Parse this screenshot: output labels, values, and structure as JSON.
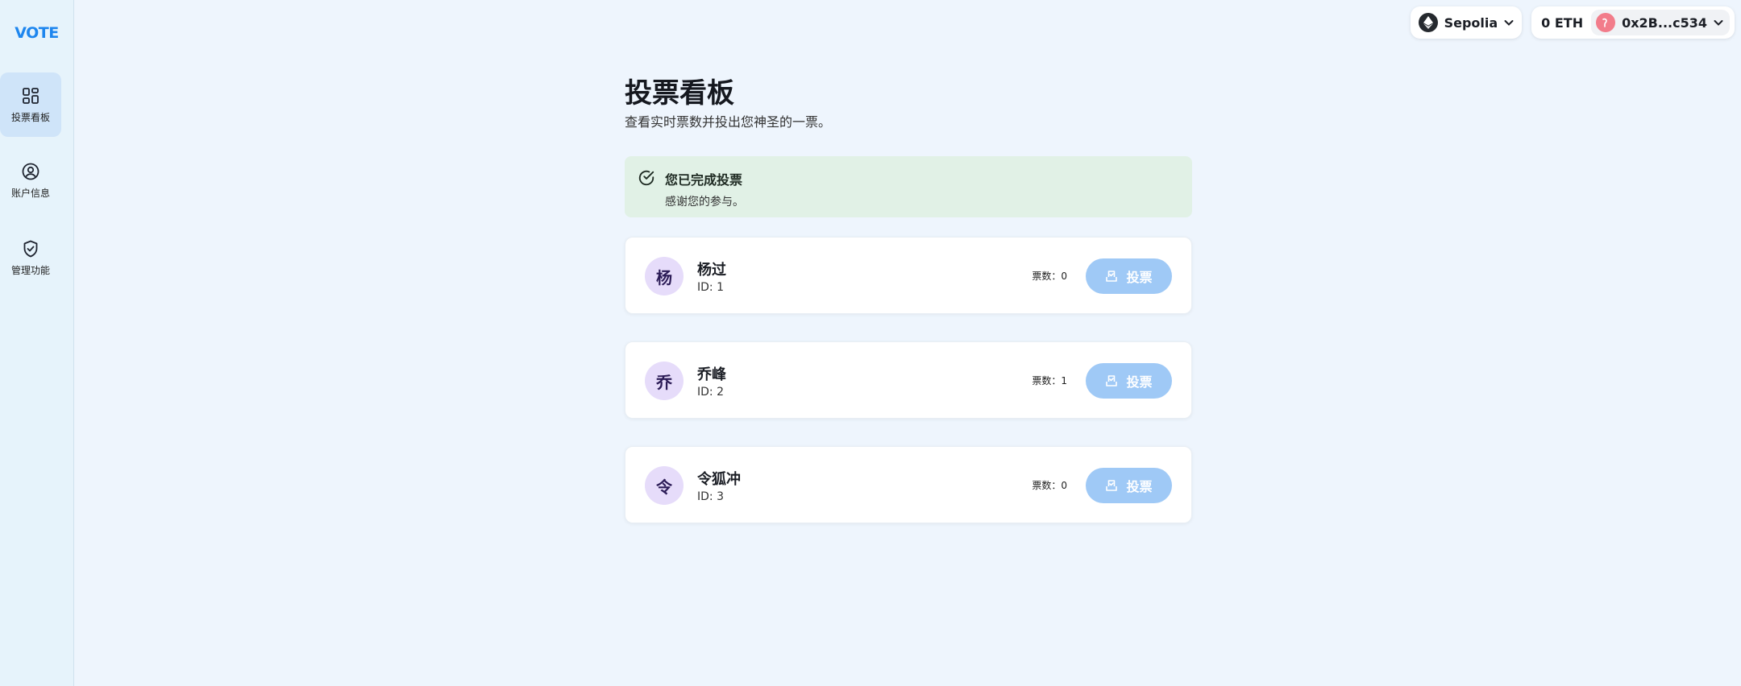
{
  "app": {
    "logo": "VOTE"
  },
  "sidebar": {
    "items": [
      {
        "label": "投票看板",
        "icon": "dashboard-icon",
        "active": true
      },
      {
        "label": "账户信息",
        "icon": "user-circle-icon",
        "active": false
      },
      {
        "label": "管理功能",
        "icon": "shield-check-icon",
        "active": false
      }
    ]
  },
  "topbar": {
    "network": "Sepolia",
    "balance": "0 ETH",
    "address": "0x2B...c534"
  },
  "page": {
    "title": "投票看板",
    "subtitle": "查看实时票数并投出您神圣的一票。"
  },
  "alert": {
    "title": "您已完成投票",
    "body": "感谢您的参与。"
  },
  "candidates": [
    {
      "initial": "杨",
      "name": "杨过",
      "id": "ID: 1",
      "votes": "票数：0",
      "button": "投票"
    },
    {
      "initial": "乔",
      "name": "乔峰",
      "id": "ID: 2",
      "votes": "票数：1",
      "button": "投票"
    },
    {
      "initial": "令",
      "name": "令狐冲",
      "id": "ID: 3",
      "votes": "票数：0",
      "button": "投票"
    }
  ],
  "colors": {
    "accent": "#1e86ee",
    "button_disabled": "#9fc9f6",
    "alert_bg": "#e1f1e6"
  }
}
